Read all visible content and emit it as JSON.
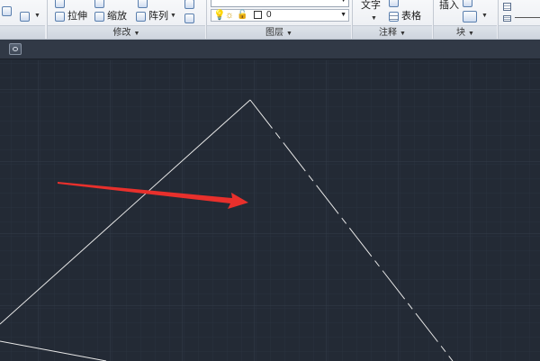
{
  "ribbon": {
    "modify": {
      "title": "修改",
      "stretch_label": "拉伸",
      "scale_label": "缩放",
      "array_label": "阵列"
    },
    "layers": {
      "title": "图层",
      "current_layer": "0"
    },
    "annotation": {
      "title": "注释",
      "text_label": "文字",
      "table_label": "表格"
    },
    "block": {
      "title": "块",
      "insert_label": "插入"
    }
  },
  "canvas": {
    "background": "#232a35",
    "line_color": "#e8e8e8",
    "arrow_color": "#e8302c"
  }
}
